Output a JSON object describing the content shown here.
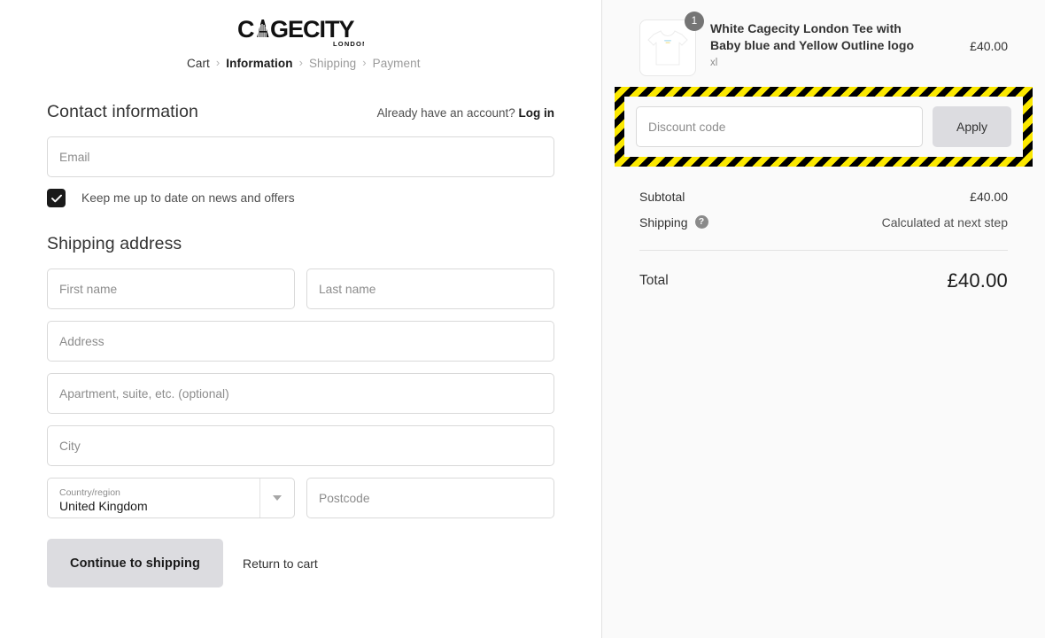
{
  "brand": {
    "name": "CAGECITY",
    "sub": "LONDON"
  },
  "breadcrumb": {
    "items": [
      {
        "label": "Cart",
        "state": "link"
      },
      {
        "label": "Information",
        "state": "current"
      },
      {
        "label": "Shipping",
        "state": "muted"
      },
      {
        "label": "Payment",
        "state": "muted"
      }
    ],
    "separator": "›"
  },
  "contact": {
    "title": "Contact information",
    "account_prompt": "Already have an account?",
    "login_label": "Log in",
    "email_placeholder": "Email",
    "email_value": "",
    "newsletter_label": "Keep me up to date on news and offers",
    "newsletter_checked": true
  },
  "shipping_address": {
    "title": "Shipping address",
    "first_name_placeholder": "First name",
    "first_name_value": "",
    "last_name_placeholder": "Last name",
    "last_name_value": "",
    "address_placeholder": "Address",
    "address_value": "",
    "apartment_placeholder": "Apartment, suite, etc. (optional)",
    "apartment_value": "",
    "city_placeholder": "City",
    "city_value": "",
    "country_label": "Country/region",
    "country_value": "United Kingdom",
    "postcode_placeholder": "Postcode",
    "postcode_value": ""
  },
  "actions": {
    "continue_label": "Continue to shipping",
    "return_label": "Return to cart"
  },
  "order_summary": {
    "items": [
      {
        "title": "White Cagecity London Tee with Baby blue and Yellow Outline logo",
        "variant": "xl",
        "quantity": "1",
        "price": "£40.00"
      }
    ],
    "discount": {
      "placeholder": "Discount code",
      "value": "",
      "apply_label": "Apply",
      "highlight_colors": {
        "stripe_a": "#000000",
        "stripe_b": "#fbe800"
      }
    },
    "subtotal_label": "Subtotal",
    "subtotal_value": "£40.00",
    "shipping_label": "Shipping",
    "shipping_help": "?",
    "shipping_value": "Calculated at next step",
    "total_label": "Total",
    "total_value": "£40.00"
  }
}
